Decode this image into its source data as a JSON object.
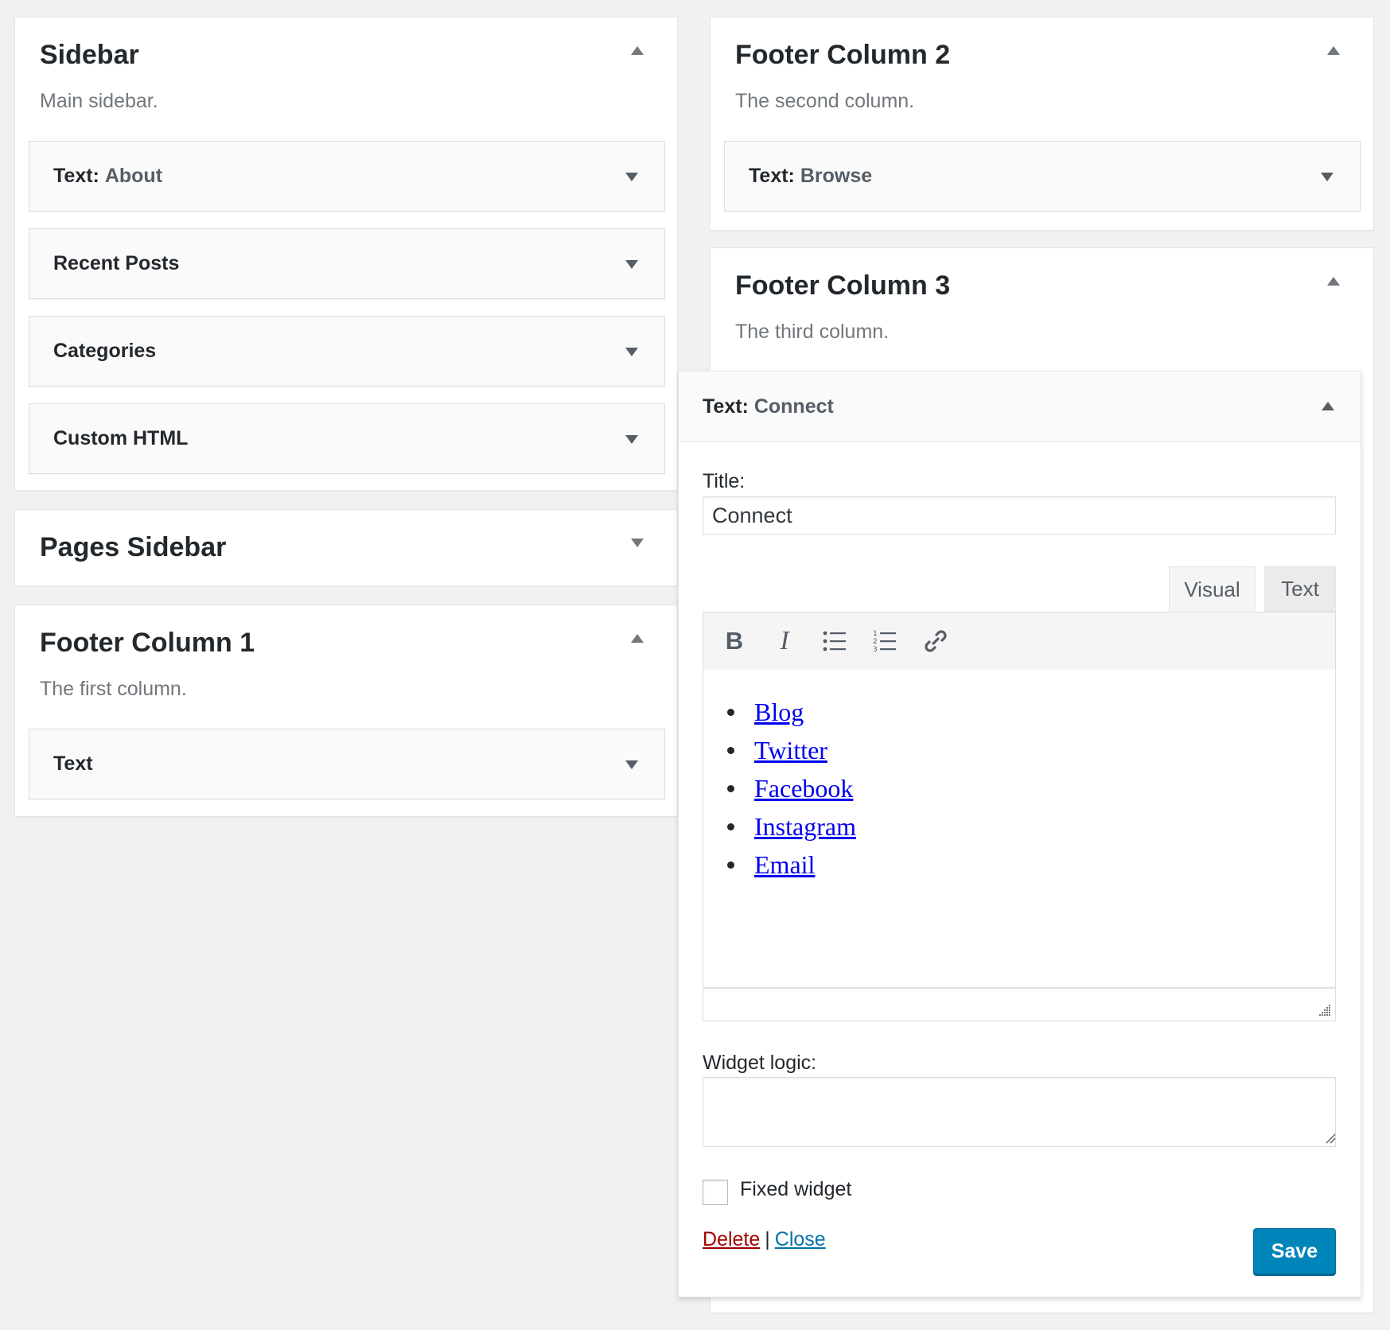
{
  "sidebar": {
    "title": "Sidebar",
    "description": "Main sidebar.",
    "toggle_icon": "arrow-up-icon",
    "widgets": [
      {
        "type": "Text:",
        "name": "About"
      },
      {
        "type": "Recent Posts",
        "name": ""
      },
      {
        "type": "Categories",
        "name": ""
      },
      {
        "type": "Custom HTML",
        "name": ""
      }
    ]
  },
  "pages_sidebar": {
    "title": "Pages Sidebar",
    "toggle_icon": "arrow-down-icon"
  },
  "footer_col1": {
    "title": "Footer Column 1",
    "description": "The first column.",
    "toggle_icon": "arrow-up-icon",
    "widgets": [
      {
        "type": "Text",
        "name": ""
      }
    ]
  },
  "footer_col2": {
    "title": "Footer Column 2",
    "description": "The second column.",
    "toggle_icon": "arrow-up-icon",
    "widgets": [
      {
        "type": "Text:",
        "name": "Browse"
      }
    ]
  },
  "footer_col3": {
    "title": "Footer Column 3",
    "description": "The third column.",
    "toggle_icon": "arrow-up-icon"
  },
  "open_widget": {
    "type": "Text:",
    "name": "Connect",
    "title_label": "Title:",
    "title_value": "Connect",
    "tabs": [
      "Visual",
      "Text"
    ],
    "active_tab": "Visual",
    "toolbar": [
      "bold-icon",
      "italic-icon",
      "bulleted-list-icon",
      "numbered-list-icon",
      "link-icon"
    ],
    "bold_glyph": "B",
    "italic_glyph": "I",
    "links": [
      "Blog",
      "Twitter",
      "Facebook",
      "Instagram",
      "Email"
    ],
    "widget_logic_label": "Widget logic:",
    "widget_logic_value": "",
    "fixed_widget_label": "Fixed widget",
    "fixed_widget_checked": false,
    "delete_label": "Delete",
    "separator": "|",
    "close_label": "Close",
    "save_label": "Save"
  },
  "colors": {
    "background": "#f1f1f1",
    "panel": "#ffffff",
    "widget_bg": "#fafafa",
    "link": "#0000ee",
    "delete": "#a00000",
    "close": "#0073aa",
    "save_button": "#0085ba"
  }
}
